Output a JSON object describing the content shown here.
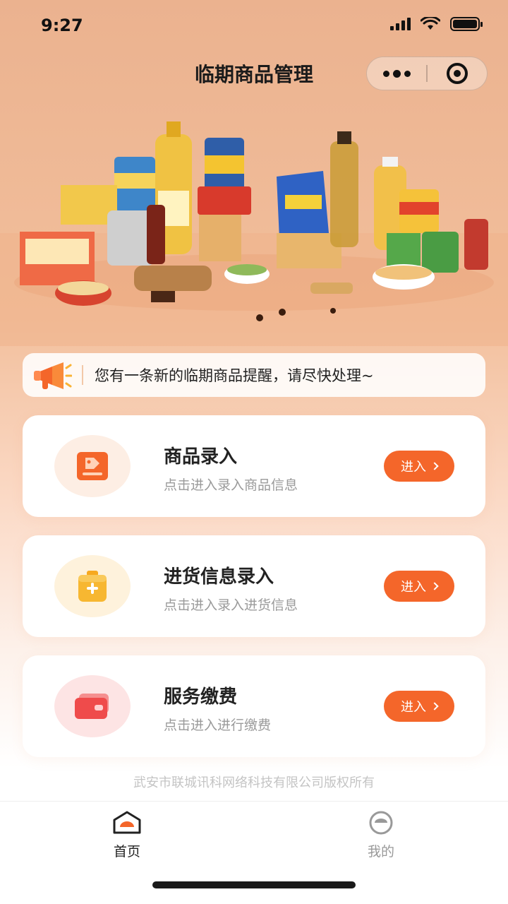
{
  "status_bar": {
    "time": "9:27"
  },
  "nav": {
    "title": "临期商品管理"
  },
  "notice": {
    "text": "您有一条新的临期商品提醒，请尽快处理~"
  },
  "cards": [
    {
      "title": "商品录入",
      "subtitle": "点击进入录入商品信息",
      "button": "进入",
      "icon": "product-tag-icon",
      "accent": "#f4662a"
    },
    {
      "title": "进货信息录入",
      "subtitle": "点击进入录入进货信息",
      "button": "进入",
      "icon": "shopping-basket-icon",
      "accent": "#f7b731"
    },
    {
      "title": "服务缴费",
      "subtitle": "点击进入进行缴费",
      "button": "进入",
      "icon": "wallet-card-icon",
      "accent": "#ef4b4b"
    }
  ],
  "footer": {
    "copyright": "武安市联城讯科网络科技有限公司版权所有"
  },
  "tabbar": {
    "items": [
      {
        "label": "首页",
        "icon": "home-icon",
        "active": true
      },
      {
        "label": "我的",
        "icon": "profile-icon",
        "active": false
      }
    ]
  },
  "colors": {
    "accent": "#f4662a",
    "text": "#222222",
    "muted": "#9a9a9a"
  }
}
